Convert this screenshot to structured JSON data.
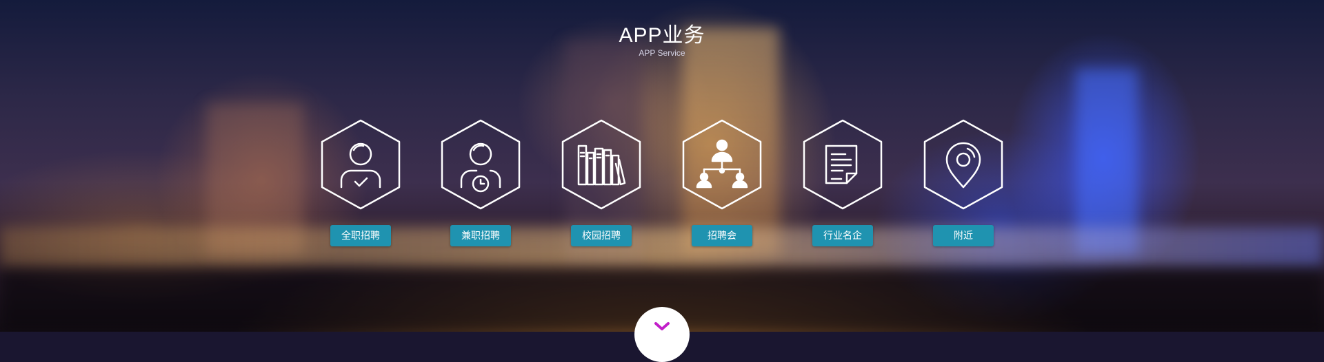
{
  "header": {
    "title": "APP业务",
    "subtitle": "APP Service"
  },
  "services": [
    {
      "label": "全职招聘",
      "icon": "user-check-icon"
    },
    {
      "label": "兼职招聘",
      "icon": "user-clock-icon"
    },
    {
      "label": "校园招聘",
      "icon": "books-icon"
    },
    {
      "label": "招聘会",
      "icon": "org-chart-icon"
    },
    {
      "label": "行业名企",
      "icon": "document-icon"
    },
    {
      "label": "附近",
      "icon": "location-pin-icon"
    }
  ],
  "colors": {
    "label_bg": "#1f93b0",
    "icon_stroke": "#ffffff",
    "chevron": "#c21fc9"
  },
  "scroll_button": {
    "icon": "chevron-down-icon"
  }
}
